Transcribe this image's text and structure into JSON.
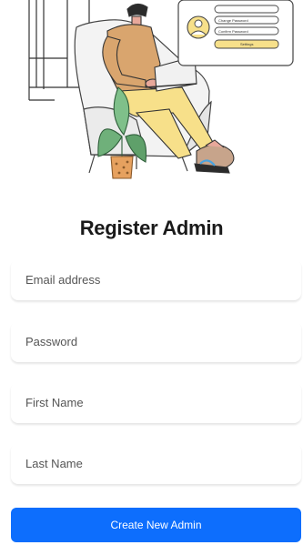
{
  "illustration": {
    "card_buttons": [
      "Change Password",
      "Confirm Password",
      "Settings"
    ]
  },
  "form": {
    "title": "Register Admin",
    "email_placeholder": "Email address",
    "password_placeholder": "Password",
    "first_name_placeholder": "First Name",
    "last_name_placeholder": "Last Name",
    "submit_label": "Create New Admin"
  },
  "colors": {
    "primary": "#0d6efd",
    "illustration_yellow": "#f7e08a",
    "illustration_shirt": "#d9a56e"
  }
}
